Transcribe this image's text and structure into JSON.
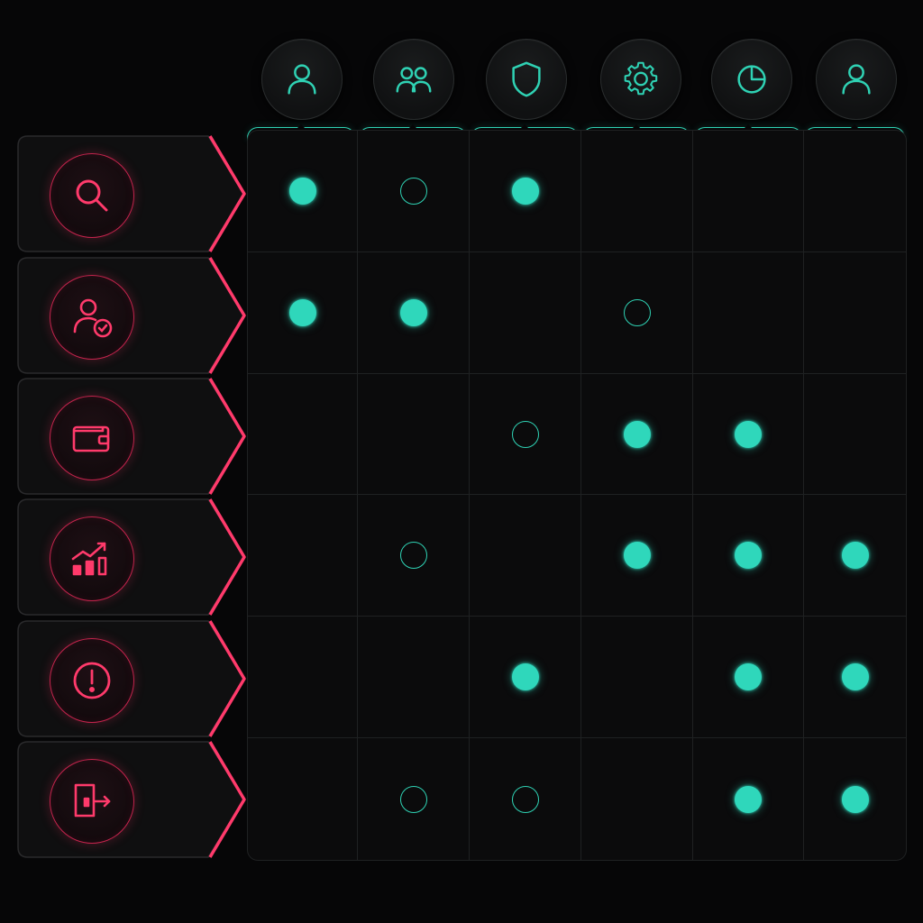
{
  "colors": {
    "background": "#060607",
    "accent_teal": "#2fd7bb",
    "accent_pink": "#ff3a6b"
  },
  "columns": [
    {
      "icon": "user-icon"
    },
    {
      "icon": "users-group-icon"
    },
    {
      "icon": "shield-icon"
    },
    {
      "icon": "gear-icon"
    },
    {
      "icon": "pie-chart-icon"
    },
    {
      "icon": "user-icon"
    }
  ],
  "rows": [
    {
      "icon": "search-icon"
    },
    {
      "icon": "user-verified-icon"
    },
    {
      "icon": "wallet-icon"
    },
    {
      "icon": "growth-chart-icon"
    },
    {
      "icon": "alert-icon"
    },
    {
      "icon": "exit-door-icon"
    }
  ],
  "matrix": [
    [
      "filled",
      "empty",
      "filled",
      "none",
      "none",
      "none"
    ],
    [
      "filled",
      "filled",
      "none",
      "empty",
      "none",
      "none"
    ],
    [
      "none",
      "none",
      "empty",
      "filled",
      "filled",
      "none"
    ],
    [
      "none",
      "empty",
      "none",
      "filled",
      "filled",
      "filled"
    ],
    [
      "none",
      "none",
      "filled",
      "none",
      "filled",
      "filled"
    ],
    [
      "none",
      "empty",
      "empty",
      "none",
      "filled",
      "filled"
    ]
  ]
}
